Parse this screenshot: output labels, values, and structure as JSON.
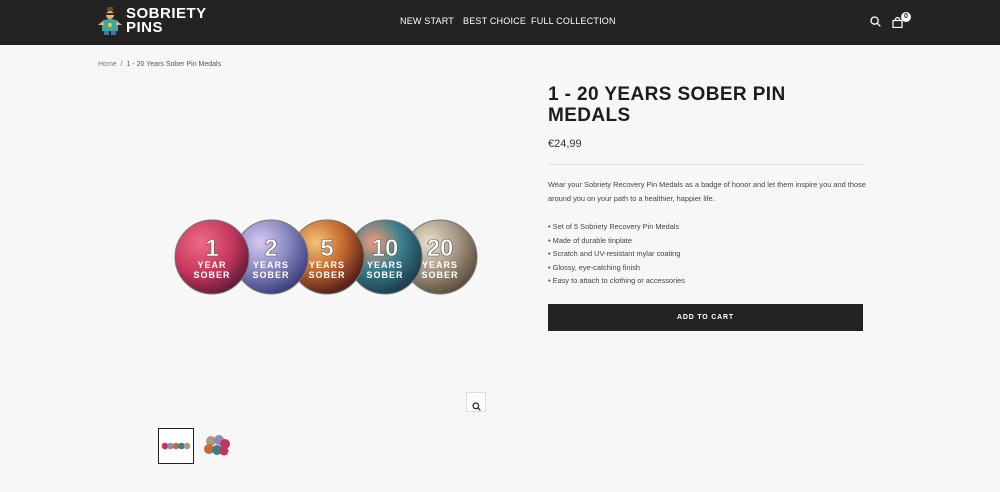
{
  "header": {
    "logo_line1": "SOBRIETY",
    "logo_line2": "PINS",
    "nav": [
      {
        "label": "NEW START"
      },
      {
        "label": "BEST CHOICE"
      },
      {
        "label": "FULL COLLECTION"
      }
    ],
    "cart_count": "0",
    "icons": [
      "search-icon",
      "cart-icon"
    ],
    "background": "#232323"
  },
  "breadcrumb": {
    "home": "Home",
    "separator": "/",
    "current": "1 - 20 Years Sober Pin Medals"
  },
  "gallery": {
    "medals": [
      {
        "number": "1",
        "line1": "YEAR",
        "line2": "SOBER",
        "color": "#c2365a"
      },
      {
        "number": "2",
        "line1": "YEARS",
        "line2": "SOBER",
        "color": "#8a8bc2"
      },
      {
        "number": "5",
        "line1": "YEARS",
        "line2": "SOBER",
        "color": "#c86a2e"
      },
      {
        "number": "10",
        "line1": "YEARS",
        "line2": "SOBER",
        "color": "#3a7f8c"
      },
      {
        "number": "20",
        "line1": "YEARS",
        "line2": "SOBER",
        "color": "#a89a86"
      }
    ],
    "zoom_icon": "zoom-icon"
  },
  "product": {
    "title": "1 - 20 YEARS SOBER PIN MEDALS",
    "price": "€24,99",
    "description": "Wear your Sobriety Recovery Pin Medals as a badge of honor and let them inspire you and those around you on your path to a healthier, happier life.",
    "features": [
      "Set of 5 Sobriety Recovery Pin Medals",
      "Made of durable tinplate",
      "Scratch and UV-resistant mylar coating",
      "Glossy, eye-catching finish",
      "Easy to attach to clothing or accessories"
    ],
    "add_to_cart": "ADD TO CART"
  }
}
